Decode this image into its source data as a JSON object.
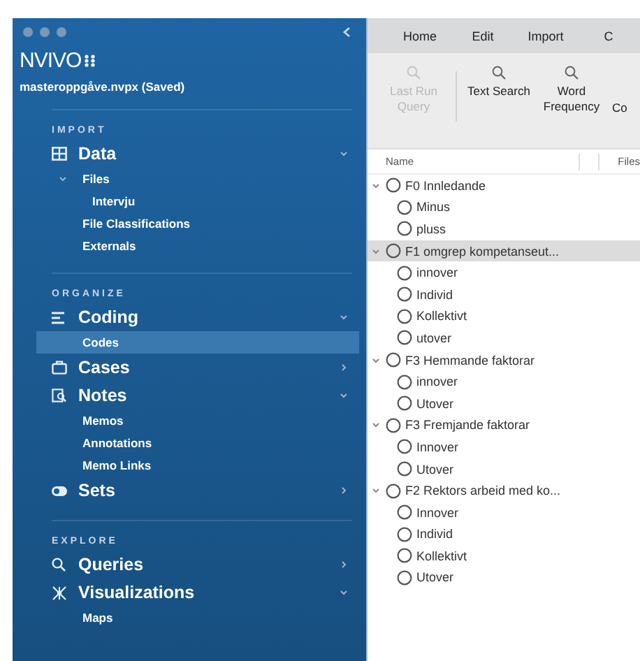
{
  "sidebar": {
    "logo": "NVIVO",
    "project": "masteroppgåve.nvpx (Saved)",
    "sections": [
      {
        "heading": "IMPORT",
        "groups": [
          {
            "label": "Data",
            "expanded": true,
            "items": [
              {
                "label": "Files",
                "selected": false,
                "expanded": true,
                "children": [
                  {
                    "label": "Intervju",
                    "selected": false
                  }
                ]
              },
              {
                "label": "File Classifications",
                "selected": false
              },
              {
                "label": "Externals",
                "selected": false
              }
            ]
          }
        ]
      },
      {
        "heading": "ORGANIZE",
        "groups": [
          {
            "label": "Coding",
            "expanded": true,
            "items": [
              {
                "label": "Codes",
                "selected": true
              }
            ]
          },
          {
            "label": "Cases",
            "expanded": false
          },
          {
            "label": "Notes",
            "expanded": true,
            "items": [
              {
                "label": "Memos",
                "selected": false
              },
              {
                "label": "Annotations",
                "selected": false
              },
              {
                "label": "Memo Links",
                "selected": false
              }
            ]
          },
          {
            "label": "Sets",
            "expanded": false
          }
        ]
      },
      {
        "heading": "EXPLORE",
        "groups": [
          {
            "label": "Queries",
            "expanded": false
          },
          {
            "label": "Visualizations",
            "expanded": true,
            "items": [
              {
                "label": "Maps",
                "selected": false
              }
            ]
          }
        ]
      }
    ]
  },
  "tabs": [
    {
      "label": "Home",
      "selected": false
    },
    {
      "label": "Edit",
      "selected": false
    },
    {
      "label": "Import",
      "selected": false
    },
    {
      "label": "C",
      "selected": false
    }
  ],
  "toolbar": [
    {
      "label": "Last Run Query",
      "disabled": true
    },
    {
      "label": "Text Search",
      "disabled": false
    },
    {
      "label": "Word Frequency",
      "disabled": false
    },
    {
      "label": "Co",
      "disabled": false
    }
  ],
  "columns": [
    "Name",
    "Files"
  ],
  "codes": [
    {
      "label": "F0 Innledande",
      "expanded": true,
      "selected": false,
      "children": [
        {
          "label": "Minus"
        },
        {
          "label": "pluss"
        }
      ]
    },
    {
      "label": "F1 omgrep kompetanseut...",
      "expanded": true,
      "selected": true,
      "children": [
        {
          "label": "innover"
        },
        {
          "label": "Individ"
        },
        {
          "label": "Kollektivt"
        },
        {
          "label": "utover"
        }
      ]
    },
    {
      "label": "F3 Hemmande faktorar",
      "expanded": true,
      "selected": false,
      "children": [
        {
          "label": "innover"
        },
        {
          "label": "Utover"
        }
      ]
    },
    {
      "label": "F3 Fremjande faktorar",
      "expanded": true,
      "selected": false,
      "children": [
        {
          "label": "Innover"
        },
        {
          "label": "Utover"
        }
      ]
    },
    {
      "label": "F2 Rektors arbeid med ko...",
      "expanded": true,
      "selected": false,
      "children": [
        {
          "label": "Innover"
        },
        {
          "label": "Individ"
        },
        {
          "label": "Kollektivt"
        },
        {
          "label": "Utover"
        }
      ]
    }
  ]
}
